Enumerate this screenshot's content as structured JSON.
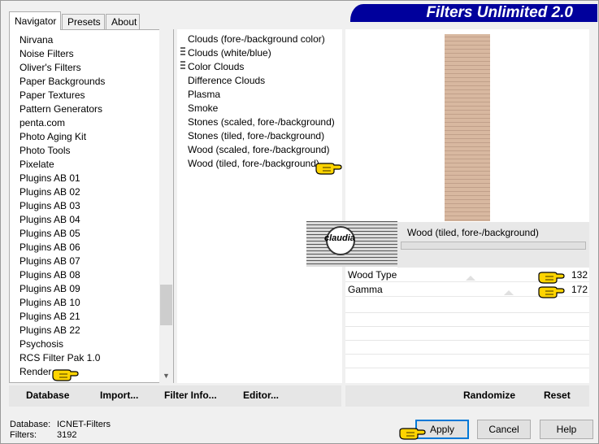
{
  "window": {
    "banner_title": "Filters Unlimited 2.0"
  },
  "tabs": [
    {
      "label": "Navigator",
      "active": true
    },
    {
      "label": "Presets",
      "active": false
    },
    {
      "label": "About",
      "active": false
    }
  ],
  "categories": {
    "items": [
      "Nirvana",
      "Noise Filters",
      "Oliver's Filters",
      "Paper Backgrounds",
      "Paper Textures",
      "Pattern Generators",
      "penta.com",
      "Photo Aging Kit",
      "Photo Tools",
      "Pixelate",
      "Plugins AB 01",
      "Plugins AB 02",
      "Plugins AB 03",
      "Plugins AB 04",
      "Plugins AB 05",
      "Plugins AB 06",
      "Plugins AB 07",
      "Plugins AB 08",
      "Plugins AB 09",
      "Plugins AB 10",
      "Plugins AB 21",
      "Plugins AB 22",
      "Psychosis",
      "RCS Filter Pak 1.0",
      "Render"
    ],
    "selected": "Render"
  },
  "filters": {
    "items": [
      "Clouds (fore-/background color)",
      "Clouds (white/blue)",
      "Color Clouds",
      "Difference Clouds",
      "Plasma",
      "Smoke",
      "Stones (scaled, fore-/background)",
      "Stones (tiled, fore-/background)",
      "Wood (scaled, fore-/background)",
      "Wood (tiled, fore-/background)"
    ],
    "selected": "Wood (tiled, fore-/background)"
  },
  "preview": {
    "filter_name": "Wood (tiled, fore-/background)",
    "watermark": "claudia",
    "color": "#d8b8a0"
  },
  "parameters": [
    {
      "name": "Wood Type",
      "value": "132"
    },
    {
      "name": "Gamma",
      "value": "172"
    }
  ],
  "left_buttons": {
    "database": "Database",
    "import": "Import...",
    "filter_info": "Filter Info...",
    "editor": "Editor..."
  },
  "right_buttons": {
    "randomize": "Randomize",
    "reset": "Reset"
  },
  "status": {
    "database_label": "Database:",
    "database_value": "ICNET-Filters",
    "filters_label": "Filters:",
    "filters_value": "3192"
  },
  "dialog_buttons": {
    "apply": "Apply",
    "cancel": "Cancel",
    "help": "Help"
  },
  "colors": {
    "banner": "#00009c",
    "hand": "#ffd400"
  }
}
